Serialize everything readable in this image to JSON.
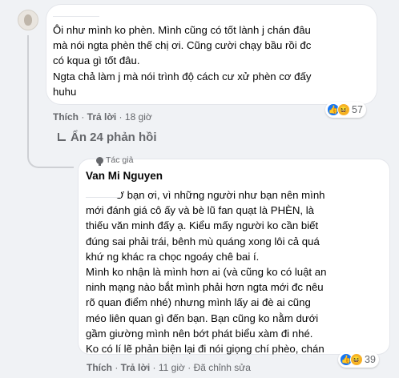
{
  "comment1": {
    "text": "Ôi như mình ko phèn. Mình cũng có tốt lành j chán đâu\nmà nói ngta phèn thế chị ơi. Cũng cười chạy bầu rồi đc\ncó kqua gì tốt đâu.\nNgta chả làm j mà nói trình độ cách cư xử phèn cơ đấy\nhuhu",
    "like_label": "Thích",
    "reply_label": "Trả lời",
    "time": "18 giờ",
    "reaction_count": "57"
  },
  "replies_toggle": "Ẩn 24 phản hồi",
  "comment2": {
    "badge": "Tác giả",
    "author": "Van Mi Nguyen",
    "text": "          Ơ bạn ơi, vì những người như bạn nên mình\nmới đánh giá cô ấy và bè lũ fan quạt là PHÈN, là\nthiếu văn minh đấy ạ. Kiểu mấy người ko cần biết\nđúng sai phải trái, bênh mù quáng xong lôi cả quá\nkhứ ng khác ra chọc ngoáy chê bai í.\nMình ko nhận là mình hơn ai (và cũng ko có luật an\nninh mạng nào bắt mình phải hơn ngta mới đc nêu\nrõ quan điểm nhé) nhưng mình lấy ai đè ai cũng\nméo liên quan gì đến bạn. Bạn cũng ko nằm dưới\ngầm giường mình nên bớt phát biểu xàm đi nhé.\nKo có lí lẽ phản biện lại đi nói giọng chí phèo, chán",
    "like_label": "Thích",
    "reply_label": "Trả lời",
    "time": "11 giờ",
    "edited": "Đã chỉnh sửa",
    "reaction_count": "39"
  },
  "colors": {
    "like": "#1877f2",
    "haha": "#f7b125",
    "muted": "#65676b"
  }
}
